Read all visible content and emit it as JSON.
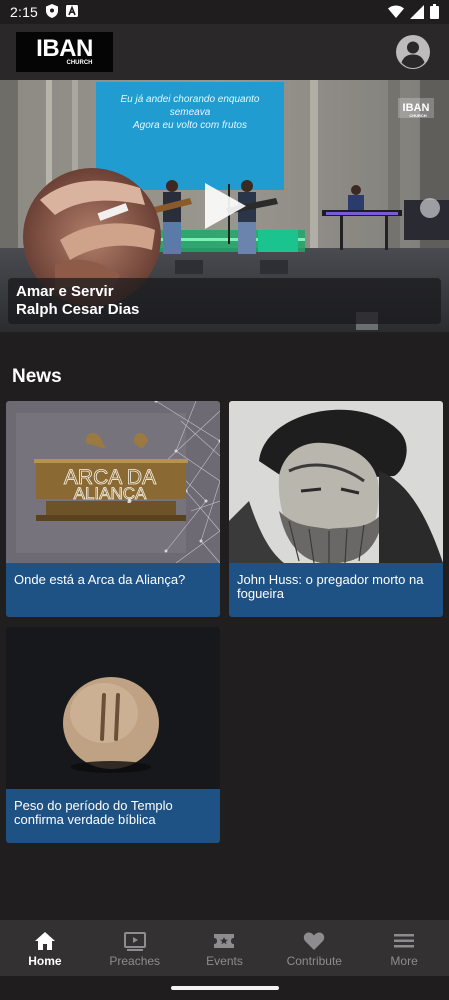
{
  "status_bar": {
    "time": "2:15",
    "icons": [
      "shield-icon",
      "a-badge-icon",
      "wifi-icon",
      "cellular-icon",
      "battery-icon"
    ]
  },
  "header": {
    "logo_text": "IBAN",
    "logo_subtext": "CHURCH",
    "profile_icon": "account-circle-icon"
  },
  "hero": {
    "title": "Amar e Servir",
    "speaker": "Ralph Cesar Dias",
    "screen_lyric_line1": "Eu já andei chorando enquanto",
    "screen_lyric_line2": "semeava",
    "screen_lyric_line3": "Agora eu volto com frutos",
    "watermark": "IBAN",
    "watermark_sub": "CHURCH",
    "play_icon": "play-icon"
  },
  "news": {
    "section_title": "News",
    "items": [
      {
        "title": "Onde está a Arca da Aliança?",
        "thumb_text_1": "ARCA DA",
        "thumb_text_2": "ALIANÇA"
      },
      {
        "title": "John Huss: o pregador morto na fogueira"
      },
      {
        "title": "Peso do período do Templo confirma verdade bíblica"
      }
    ]
  },
  "bottom_nav": {
    "items": [
      {
        "label": "Home",
        "icon": "home-icon",
        "active": true
      },
      {
        "label": "Preaches",
        "icon": "video-library-icon",
        "active": false
      },
      {
        "label": "Events",
        "icon": "ticket-icon",
        "active": false
      },
      {
        "label": "Contribute",
        "icon": "heart-icon",
        "active": false
      },
      {
        "label": "More",
        "icon": "menu-icon",
        "active": false
      }
    ]
  },
  "colors": {
    "background": "#201e1f",
    "header": "#2a2829",
    "news_title_bar": "#1e5184",
    "nav_background": "#333132",
    "nav_inactive": "#8e8c8e"
  }
}
